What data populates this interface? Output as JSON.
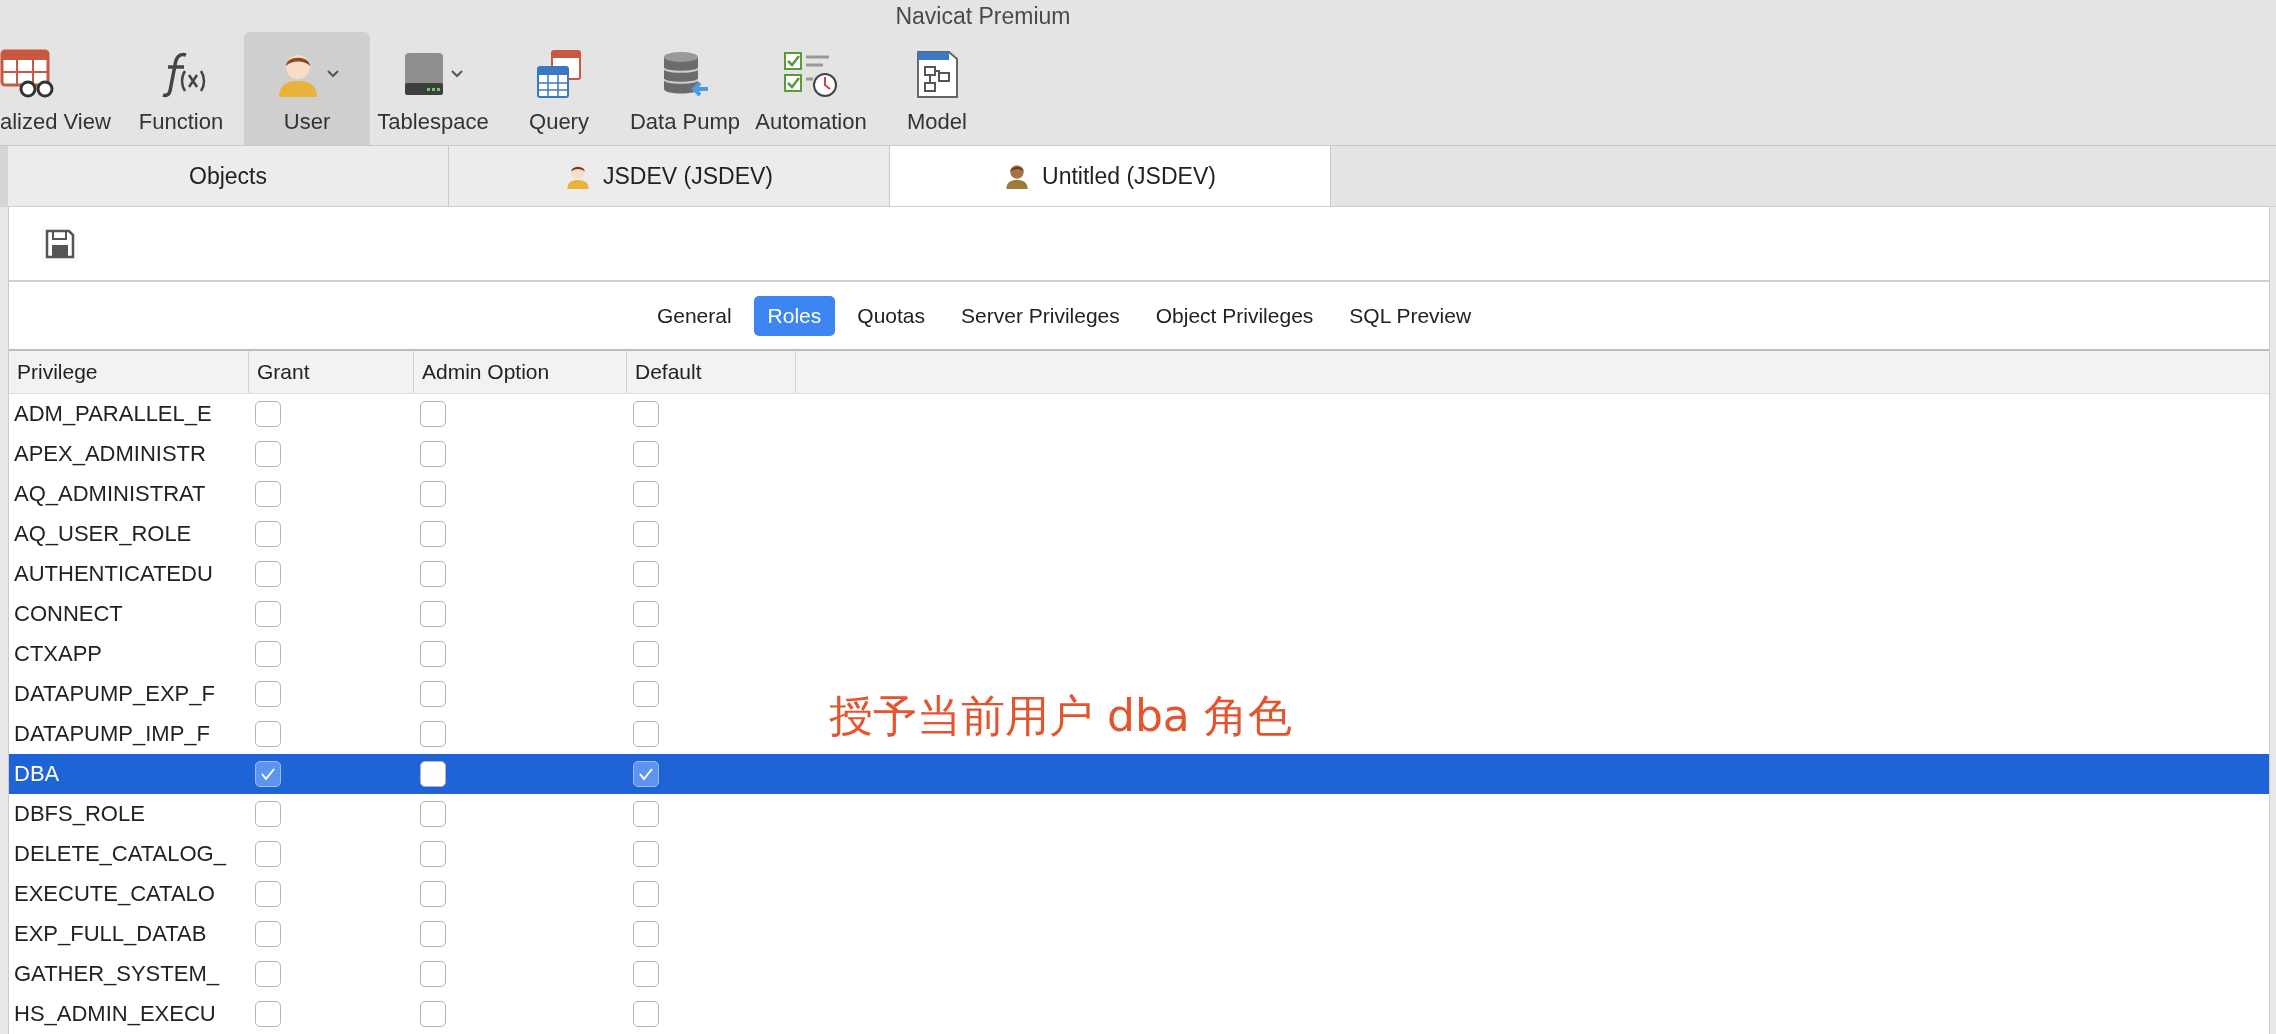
{
  "window": {
    "title": "Navicat Premium"
  },
  "toolbar": [
    {
      "kind": "view",
      "label": "alized View",
      "selected": false,
      "dropdown": false
    },
    {
      "kind": "function",
      "label": "Function",
      "selected": false,
      "dropdown": false
    },
    {
      "kind": "user",
      "label": "User",
      "selected": true,
      "dropdown": true
    },
    {
      "kind": "tablespace",
      "label": "Tablespace",
      "selected": false,
      "dropdown": true
    },
    {
      "kind": "query",
      "label": "Query",
      "selected": false,
      "dropdown": false
    },
    {
      "kind": "datapump",
      "label": "Data Pump",
      "selected": false,
      "dropdown": false
    },
    {
      "kind": "automation",
      "label": "Automation",
      "selected": false,
      "dropdown": false
    },
    {
      "kind": "model",
      "label": "Model",
      "selected": false,
      "dropdown": false
    }
  ],
  "tabs": [
    {
      "kind": "plain",
      "label": "Objects",
      "selected": false
    },
    {
      "kind": "user",
      "label": "JSDEV (JSDEV)",
      "selected": false
    },
    {
      "kind": "user-dark",
      "label": "Untitled (JSDEV)",
      "selected": true
    }
  ],
  "subtabs": [
    {
      "label": "General",
      "selected": false
    },
    {
      "label": "Roles",
      "selected": true
    },
    {
      "label": "Quotas",
      "selected": false
    },
    {
      "label": "Server Privileges",
      "selected": false
    },
    {
      "label": "Object Privileges",
      "selected": false
    },
    {
      "label": "SQL Preview",
      "selected": false
    }
  ],
  "table": {
    "columns": [
      "Privilege",
      "Grant",
      "Admin Option",
      "Default"
    ],
    "rows": [
      {
        "privilege": "ADM_PARALLEL_E",
        "grant": false,
        "admin_option": false,
        "default": false,
        "selected": false
      },
      {
        "privilege": "APEX_ADMINISTR",
        "grant": false,
        "admin_option": false,
        "default": false,
        "selected": false
      },
      {
        "privilege": "AQ_ADMINISTRAT",
        "grant": false,
        "admin_option": false,
        "default": false,
        "selected": false
      },
      {
        "privilege": "AQ_USER_ROLE",
        "grant": false,
        "admin_option": false,
        "default": false,
        "selected": false
      },
      {
        "privilege": "AUTHENTICATEDU",
        "grant": false,
        "admin_option": false,
        "default": false,
        "selected": false
      },
      {
        "privilege": "CONNECT",
        "grant": false,
        "admin_option": false,
        "default": false,
        "selected": false
      },
      {
        "privilege": "CTXAPP",
        "grant": false,
        "admin_option": false,
        "default": false,
        "selected": false
      },
      {
        "privilege": "DATAPUMP_EXP_F",
        "grant": false,
        "admin_option": false,
        "default": false,
        "selected": false
      },
      {
        "privilege": "DATAPUMP_IMP_F",
        "grant": false,
        "admin_option": false,
        "default": false,
        "selected": false
      },
      {
        "privilege": "DBA",
        "grant": true,
        "admin_option": false,
        "default": true,
        "selected": true
      },
      {
        "privilege": "DBFS_ROLE",
        "grant": false,
        "admin_option": false,
        "default": false,
        "selected": false
      },
      {
        "privilege": "DELETE_CATALOG_",
        "grant": false,
        "admin_option": false,
        "default": false,
        "selected": false
      },
      {
        "privilege": "EXECUTE_CATALO",
        "grant": false,
        "admin_option": false,
        "default": false,
        "selected": false
      },
      {
        "privilege": "EXP_FULL_DATAB",
        "grant": false,
        "admin_option": false,
        "default": false,
        "selected": false
      },
      {
        "privilege": "GATHER_SYSTEM_",
        "grant": false,
        "admin_option": false,
        "default": false,
        "selected": false
      },
      {
        "privilege": "HS_ADMIN_EXECU",
        "grant": false,
        "admin_option": false,
        "default": false,
        "selected": false
      }
    ]
  },
  "annotation": "授予当前用户 dba 角色"
}
